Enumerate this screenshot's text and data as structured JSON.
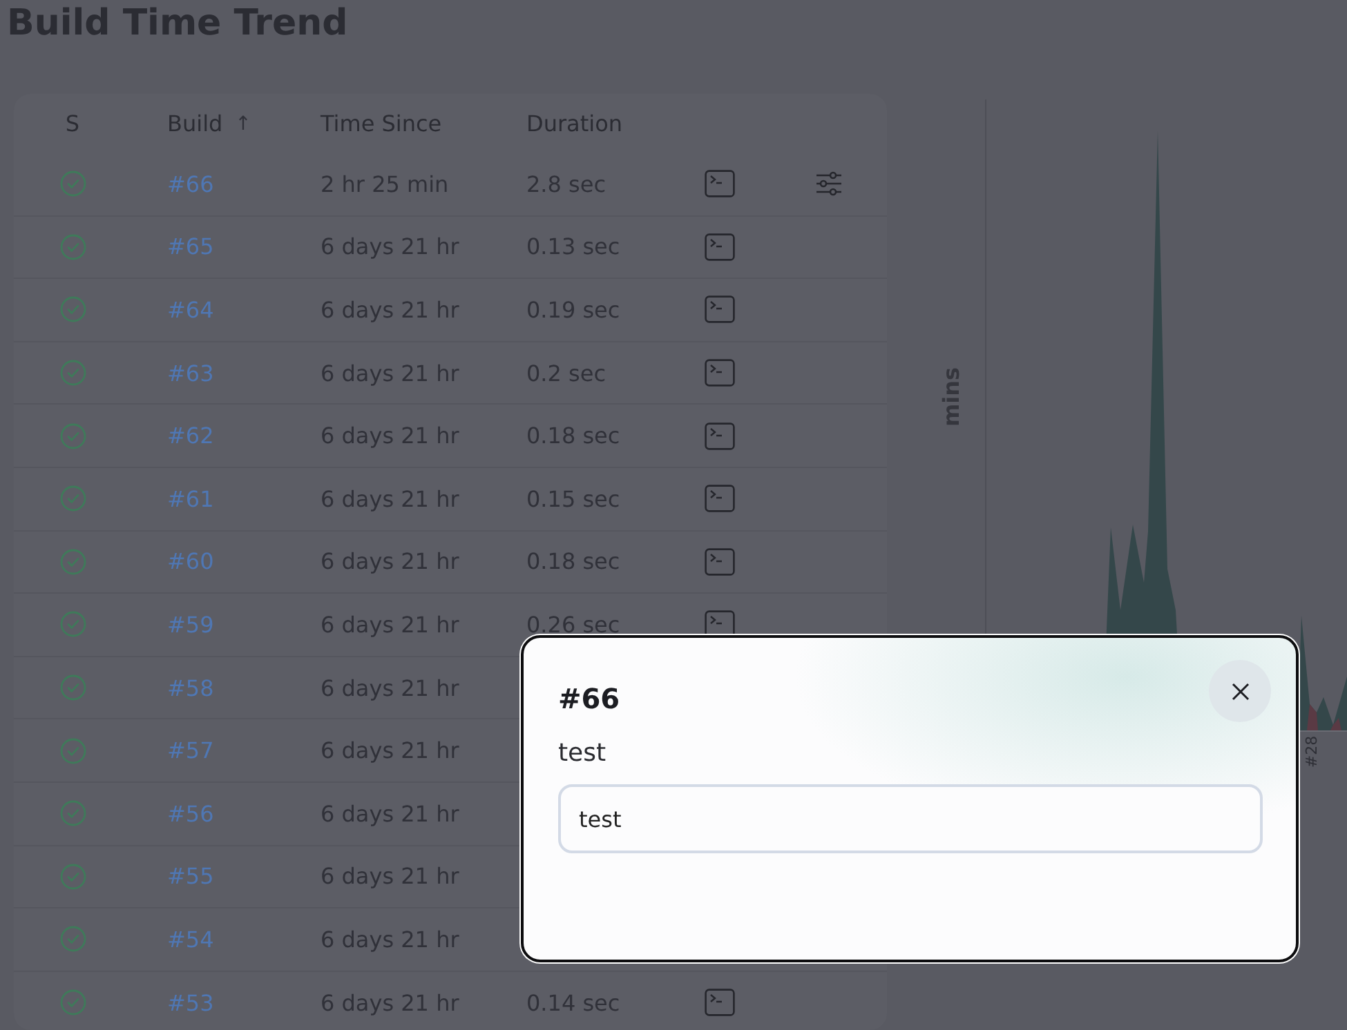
{
  "page": {
    "title": "Build Time Trend"
  },
  "table": {
    "columns": [
      {
        "label": "S"
      },
      {
        "label": "Build",
        "sort_indicator": "↑"
      },
      {
        "label": "Time Since"
      },
      {
        "label": "Duration"
      }
    ],
    "rows": [
      {
        "success": true,
        "build": "#66",
        "time_since": "2 hr 25 min",
        "duration": "2.8 sec",
        "options": true
      },
      {
        "success": true,
        "build": "#65",
        "time_since": "6 days 21 hr",
        "duration": "0.13 sec",
        "options": false
      },
      {
        "success": true,
        "build": "#64",
        "time_since": "6 days 21 hr",
        "duration": "0.19 sec",
        "options": false
      },
      {
        "success": true,
        "build": "#63",
        "time_since": "6 days 21 hr",
        "duration": "0.2 sec",
        "options": false
      },
      {
        "success": true,
        "build": "#62",
        "time_since": "6 days 21 hr",
        "duration": "0.18 sec",
        "options": false
      },
      {
        "success": true,
        "build": "#61",
        "time_since": "6 days 21 hr",
        "duration": "0.15 sec",
        "options": false
      },
      {
        "success": true,
        "build": "#60",
        "time_since": "6 days 21 hr",
        "duration": "0.18 sec",
        "options": false
      },
      {
        "success": true,
        "build": "#59",
        "time_since": "6 days 21 hr",
        "duration": "0.26 sec",
        "options": false
      },
      {
        "success": true,
        "build": "#58",
        "time_since": "6 days 21 hr",
        "options": false
      },
      {
        "success": true,
        "build": "#57",
        "time_since": "6 days 21 hr",
        "options": false
      },
      {
        "success": true,
        "build": "#56",
        "time_since": "6 days 21 hr",
        "options": false
      },
      {
        "success": true,
        "build": "#55",
        "time_since": "6 days 21 hr",
        "options": false
      },
      {
        "success": true,
        "build": "#54",
        "time_since": "6 days 21 hr",
        "options": false
      },
      {
        "success": true,
        "build": "#53",
        "time_since": "6 days 21 hr",
        "duration": "0.14 sec",
        "options": false
      }
    ]
  },
  "chart": {
    "ylabel": "mins",
    "x_labels": [
      "#28"
    ]
  },
  "dialog": {
    "title": "#66",
    "field_label": "test",
    "field_value": "test"
  }
}
